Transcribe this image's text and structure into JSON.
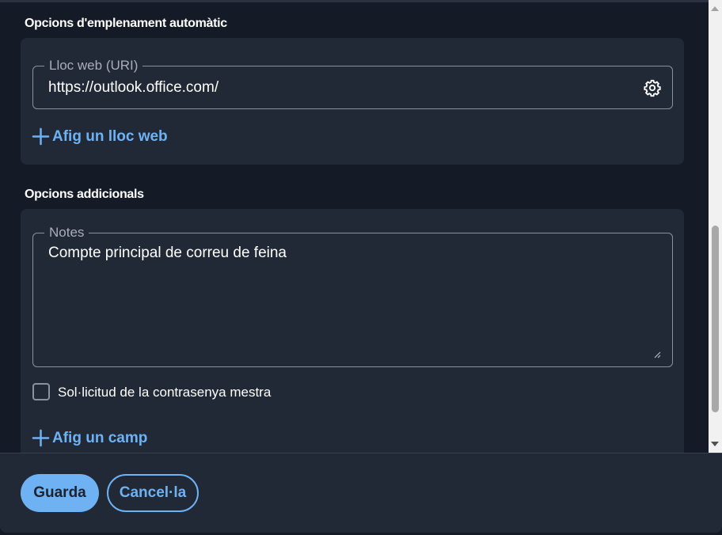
{
  "autofill": {
    "title": "Opcions d'emplenament automàtic",
    "uri_label": "Lloc web (URI)",
    "uri_value": "https://outlook.office.com/",
    "settings_icon": "gear-icon",
    "add_website": "Afig un lloc web"
  },
  "additional": {
    "title": "Opcions addicionals",
    "notes_label": "Notes",
    "notes_value": "Compte principal de correu de feina",
    "reprompt_label": "Sol·licitud de la contrasenya mestra",
    "reprompt_checked": false,
    "add_field": "Afig un camp"
  },
  "footer": {
    "save": "Guarda",
    "cancel": "Cancel·la"
  },
  "colors": {
    "background": "#151b26",
    "card": "#212836",
    "accent": "#6fb2f4",
    "border": "#8b919c"
  }
}
